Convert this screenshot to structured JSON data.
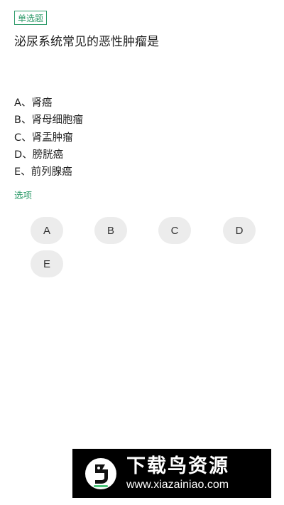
{
  "question": {
    "type_badge": "单选题",
    "text": "泌尿系统常见的恶性肿瘤是",
    "options": [
      "A、肾癌",
      "B、肾母细胞瘤",
      "C、肾盂肿瘤",
      "D、膀胱癌",
      "E、前列腺癌"
    ]
  },
  "answer_section": {
    "label": "选项",
    "choices": [
      "A",
      "B",
      "C",
      "D",
      "E"
    ]
  },
  "watermark": {
    "title": "下载鸟资源",
    "url": "www.xiazainiao.com"
  },
  "colors": {
    "accent": "#2e9b6a",
    "choice_bg": "#ececec",
    "text": "#222222"
  }
}
